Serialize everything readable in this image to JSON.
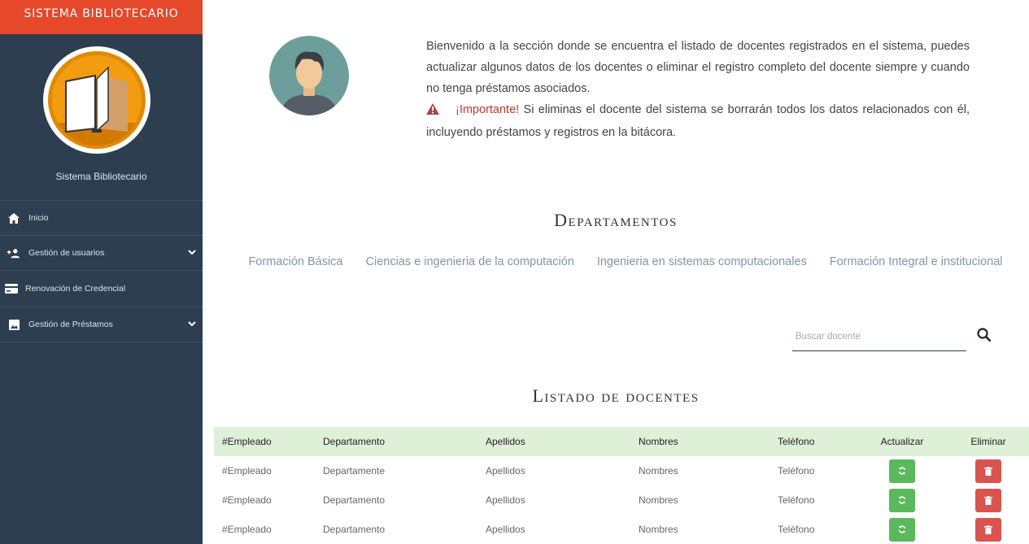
{
  "sidebar": {
    "header": "SISTEMA BIBLIOTECARIO",
    "profile_name": "Sistema Bibliotecario",
    "items": [
      {
        "label": "Inicio",
        "icon": "home-icon",
        "has_submenu": false
      },
      {
        "label": "Gestión de usuarios",
        "icon": "add-user-icon",
        "has_submenu": true
      },
      {
        "label": "Renovación de Credencial",
        "icon": "credit-card-icon",
        "has_submenu": false
      },
      {
        "label": "Gestión de Préstamos",
        "icon": "image-icon",
        "has_submenu": true
      }
    ]
  },
  "intro": {
    "text": "Bienvenido a la sección donde se encuentra el listado de docentes registrados en el sistema, puedes actualizar algunos datos de los docentes o eliminar el registro completo del docente siempre y cuando no tenga préstamos asociados.",
    "important_label": "¡Importante!",
    "important_text": "Si eliminas el docente del sistema se borrarán todos los datos relacionados con él, incluyendo préstamos y registros en la bitácora."
  },
  "departments": {
    "title": "Departamentos",
    "links": [
      "Formación Básica",
      "Ciencias e ingenieria de la computación",
      "Ingenieria en sistemas computacionales",
      "Formación Integral e institucional"
    ]
  },
  "search": {
    "placeholder": "Buscar docente",
    "value": ""
  },
  "list": {
    "title": "Listado de docentes",
    "columns": [
      "#Empleado",
      "Departamento",
      "Apellidos",
      "Nombres",
      "Teléfono",
      "Actualizar",
      "Eliminar"
    ],
    "rows": [
      [
        "#Empleado",
        "Departamente",
        "Apellidos",
        "Nombres",
        "Teléfono"
      ],
      [
        "#Empleado",
        "Departamento",
        "Apellidos",
        "Nombres",
        "Teléfono"
      ],
      [
        "#Empleado",
        "Departamento",
        "Apellidos",
        "Nombres",
        "Teléfono"
      ]
    ]
  },
  "colors": {
    "sidebar_bg": "#2c3e50",
    "header_bg": "#e5482a",
    "table_header_bg": "#dff0d8",
    "update_btn": "#5cb85c",
    "delete_btn": "#d9534f",
    "important_text": "#c0392b"
  }
}
